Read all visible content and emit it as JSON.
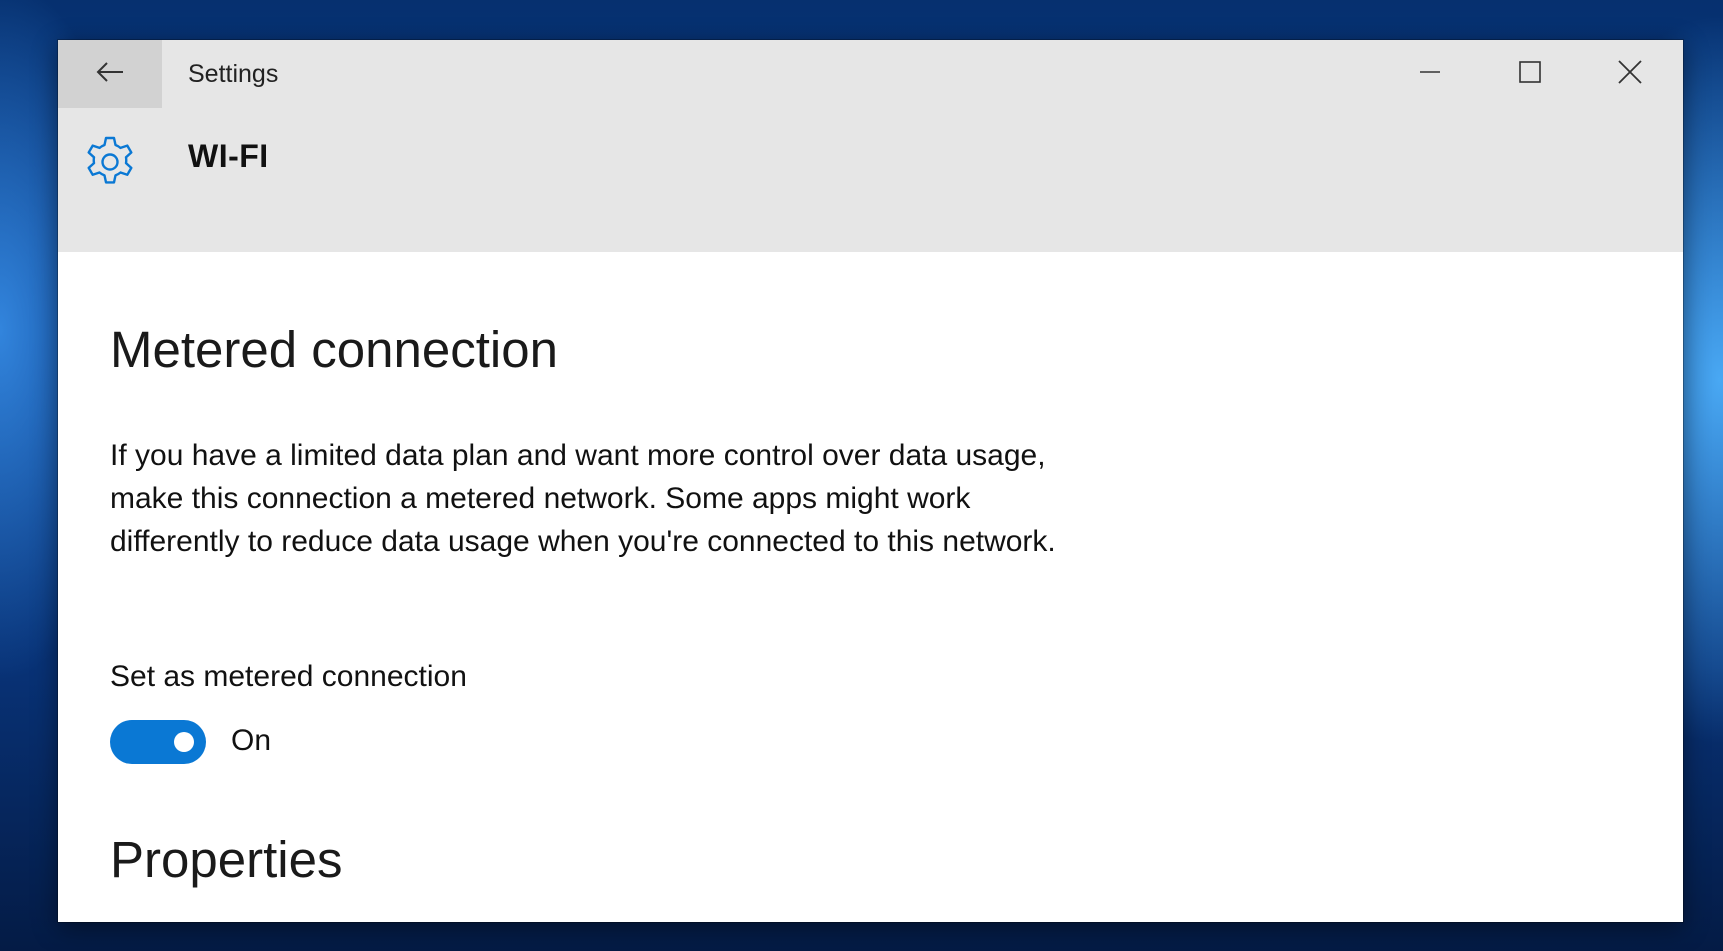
{
  "window": {
    "title": "Settings"
  },
  "header": {
    "title": "WI-FI",
    "icon": "gear-icon",
    "accent_color": "#0a78d4"
  },
  "metered": {
    "heading": "Metered connection",
    "description": "If you have a limited data plan and want more control over data usage, make this connection a metered network. Some apps might work differently to reduce data usage when you're connected to this network.",
    "setting_label": "Set as metered connection",
    "toggle_state_label": "On",
    "toggle_on": true
  },
  "properties": {
    "heading": "Properties"
  },
  "icons": {
    "back": "arrow-left-icon",
    "minimize": "minimize-icon",
    "maximize": "maximize-icon",
    "close": "close-icon"
  }
}
